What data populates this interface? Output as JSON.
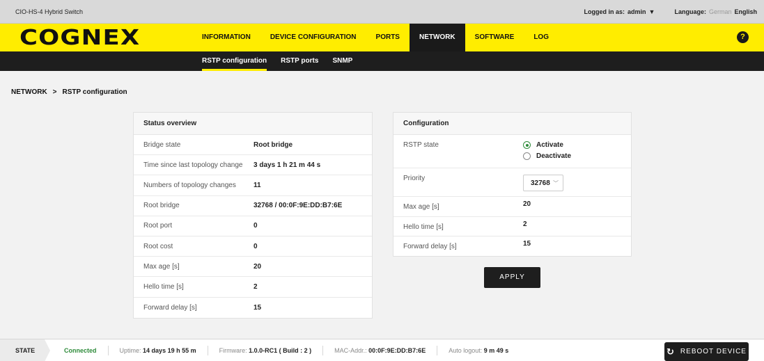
{
  "topbar": {
    "device_name": "CIO-HS-4 Hybrid Switch",
    "logged_in_label": "Logged in as:",
    "user": "admin",
    "user_caret": "▼",
    "language_label": "Language:",
    "lang_german": "German",
    "lang_english": "English"
  },
  "header": {
    "logo": "COGNEX",
    "nav": [
      "INFORMATION",
      "DEVICE CONFIGURATION",
      "PORTS",
      "NETWORK",
      "SOFTWARE",
      "LOG"
    ],
    "active_nav": "NETWORK",
    "help_icon": "?"
  },
  "subnav": {
    "items": [
      "RSTP configuration",
      "RSTP ports",
      "SNMP"
    ],
    "active": "RSTP configuration"
  },
  "breadcrumb": {
    "section": "NETWORK",
    "separator": ">",
    "page": "RSTP configuration"
  },
  "status_overview": {
    "title": "Status overview",
    "rows": [
      {
        "label": "Bridge state",
        "value": "Root bridge"
      },
      {
        "label": "Time since last topology change",
        "value": "3 days 1 h 21 m 44 s"
      },
      {
        "label": "Numbers of topology changes",
        "value": "11"
      },
      {
        "label": "Root bridge",
        "value": "32768 / 00:0F:9E:DD:B7:6E"
      },
      {
        "label": "Root port",
        "value": "0"
      },
      {
        "label": "Root cost",
        "value": "0"
      },
      {
        "label": "Max age [s]",
        "value": "20"
      },
      {
        "label": "Hello time [s]",
        "value": "2"
      },
      {
        "label": "Forward delay [s]",
        "value": "15"
      }
    ]
  },
  "configuration": {
    "title": "Configuration",
    "rstp_state_label": "RSTP state",
    "rstp_options": [
      "Activate",
      "Deactivate"
    ],
    "rstp_selected": "Activate",
    "priority_label": "Priority",
    "priority_value": "32768",
    "max_age_label": "Max age [s]",
    "max_age_value": "20",
    "hello_time_label": "Hello time [s]",
    "hello_time_value": "2",
    "forward_delay_label": "Forward delay [s]",
    "forward_delay_value": "15",
    "apply_label": "APPLY"
  },
  "footer": {
    "state_label": "STATE",
    "connection_status": "Connected",
    "uptime_label": "Uptime:",
    "uptime_value": "14 days 19 h 55 m",
    "firmware_label": "Firmware:",
    "firmware_value": "1.0.0-RC1 ( Build : 2 )",
    "mac_label": "MAC-Addr.:",
    "mac_value": "00:0F:9E:DD:B7:6E",
    "auto_logout_label": "Auto logout:",
    "auto_logout_value": "9 m 49 s",
    "reboot_label": "REBOOT DEVICE",
    "reboot_icon": "reload-icon"
  },
  "colors": {
    "brand_yellow": "#ffed00",
    "dark": "#1e1e1e",
    "connected_green": "#2e8b3a"
  }
}
